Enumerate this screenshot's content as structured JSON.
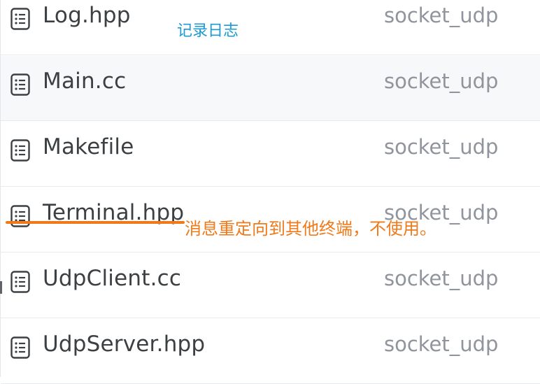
{
  "files": [
    {
      "name": "Log.hpp",
      "folder": "socket_udp",
      "icon": "file-list-icon"
    },
    {
      "name": "Main.cc",
      "folder": "socket_udp",
      "icon": "file-list-icon"
    },
    {
      "name": "Makefile",
      "folder": "socket_udp",
      "icon": "file-list-icon"
    },
    {
      "name": "Terminal.hpp",
      "folder": "socket_udp",
      "icon": "file-list-icon"
    },
    {
      "name": "UdpClient.cc",
      "folder": "socket_udp",
      "icon": "file-list-icon"
    },
    {
      "name": "UdpServer.hpp",
      "folder": "socket_udp",
      "icon": "file-list-icon"
    }
  ],
  "annotations": {
    "log_note": "记录日志",
    "terminal_note": "消息重定向到其他终端，不使用。"
  },
  "colors": {
    "annotation_blue": "#1a9bd7",
    "annotation_orange": "#f07a1a",
    "folder_text": "#90949c"
  }
}
